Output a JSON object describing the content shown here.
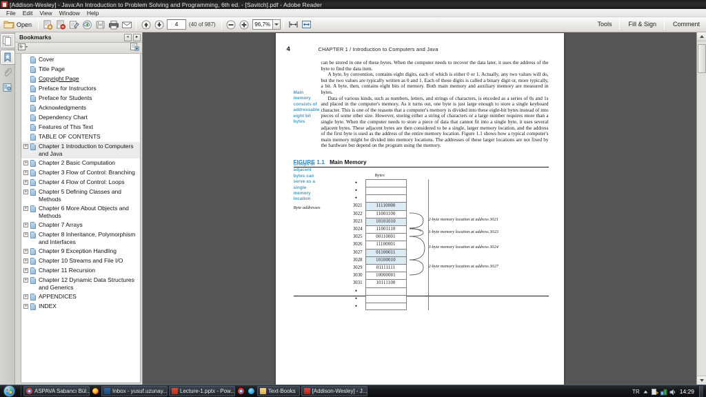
{
  "window": {
    "title": "[Addison-Wesley] - Java:An Introduction to Problem Solving and Programming, 6th ed. - [Savitch].pdf - Adobe Reader",
    "app_icon": "adobe-reader-icon"
  },
  "menubar": {
    "items": [
      "File",
      "Edit",
      "View",
      "Window",
      "Help"
    ]
  },
  "toolbar": {
    "open_label": "Open",
    "page_value": "4",
    "page_count_label": "(40 of 987)",
    "zoom_value": "96,7%",
    "right_buttons": [
      "Tools",
      "Fill & Sign",
      "Comment"
    ],
    "icons": [
      "open-folder-icon",
      "save-file-icon",
      "attach-file-icon",
      "sign-document-icon",
      "upload-cloud-icon",
      "save-disk-icon",
      "print-icon",
      "email-icon",
      "previous-page-icon",
      "next-page-icon",
      "zoom-out-icon",
      "zoom-in-icon",
      "zoom-dropdown-icon",
      "fit-width-icon",
      "fit-page-icon"
    ]
  },
  "rail": {
    "items": [
      {
        "name": "page-thumbnails-icon",
        "label": "Page Thumbnails"
      },
      {
        "name": "bookmarks-icon",
        "label": "Bookmarks"
      },
      {
        "name": "attachments-icon",
        "label": "Attachments"
      },
      {
        "name": "signatures-icon",
        "label": "Signatures"
      }
    ]
  },
  "bookmarks_panel": {
    "header": "Bookmarks",
    "collapse_label": "«",
    "options_label": "▸",
    "items": [
      {
        "label": "Cover",
        "expandable": false,
        "link": false,
        "selected": false
      },
      {
        "label": "Title Page",
        "expandable": false,
        "link": false,
        "selected": false
      },
      {
        "label": "Copyright Page",
        "expandable": false,
        "link": true,
        "selected": false
      },
      {
        "label": "Preface for Instructors",
        "expandable": false,
        "link": false,
        "selected": false
      },
      {
        "label": "Preface for Students",
        "expandable": false,
        "link": false,
        "selected": false
      },
      {
        "label": "Acknowledgments",
        "expandable": false,
        "link": false,
        "selected": false
      },
      {
        "label": "Dependency Chart",
        "expandable": false,
        "link": false,
        "selected": false
      },
      {
        "label": "Features of This Text",
        "expandable": false,
        "link": false,
        "selected": false
      },
      {
        "label": "TABLE OF CONTENTS",
        "expandable": false,
        "link": false,
        "selected": false
      },
      {
        "label": "Chapter 1 Introduction to Computers and Java",
        "expandable": true,
        "link": false,
        "selected": true
      },
      {
        "label": "Chapter 2 Basic Computation",
        "expandable": true,
        "link": false,
        "selected": false
      },
      {
        "label": "Chapter 3 Flow of Control: Branching",
        "expandable": true,
        "link": false,
        "selected": false
      },
      {
        "label": "Chapter 4 Flow of Control: Loops",
        "expandable": true,
        "link": false,
        "selected": false
      },
      {
        "label": "Chapter 5 Defining Classes and Methods",
        "expandable": true,
        "link": false,
        "selected": false
      },
      {
        "label": "Chapter 6 More About Objects and Methods",
        "expandable": true,
        "link": false,
        "selected": false
      },
      {
        "label": "Chapter 7 Arrays",
        "expandable": true,
        "link": false,
        "selected": false
      },
      {
        "label": "Chapter 8 Inheritance, Polymorphism and Interfaces",
        "expandable": true,
        "link": false,
        "selected": false
      },
      {
        "label": "Chapter 9 Exception Handling",
        "expandable": true,
        "link": false,
        "selected": false
      },
      {
        "label": "Chapter 10 Streams and File I/O",
        "expandable": true,
        "link": false,
        "selected": false
      },
      {
        "label": "Chapter 11 Recursion",
        "expandable": true,
        "link": false,
        "selected": false
      },
      {
        "label": "Chapter 12 Dynamic Data Structures and Generics",
        "expandable": true,
        "link": false,
        "selected": false
      },
      {
        "label": "APPENDICES",
        "expandable": true,
        "link": false,
        "selected": false
      },
      {
        "label": "INDEX",
        "expandable": true,
        "link": false,
        "selected": false
      }
    ]
  },
  "document": {
    "page_number": "4",
    "running_head": "CHAPTER 1 / Introduction to Computers and Java",
    "margin_notes": [
      "Main memory consists of addressable eight bit bytes",
      "Groups of adjacent bytes can serve as a single memory location"
    ],
    "paragraphs": [
      "can be stored in one of these bytes. When the computer needs to recover the data later, it uses the address of the byte to find the data item.",
      "A byte, by convention, contains eight digits, each of which is either 0 or 1. Actually, any two values will do, but the two values are typically written as 0 and 1. Each of these digits is called a binary digit or, more typically, a bit. A byte, then, contains eight bits of memory. Both main memory and auxiliary memory are measured in bytes.",
      "Data of various kinds, such as numbers, letters, and strings of characters, is encoded as a series of 0s and 1s and placed in the computer's memory. As it turns out, one byte is just large enough to store a single keyboard character. This is one of the reasons that a computer's memory is divided into these eight-bit bytes instead of into pieces of some other size. However, storing either a string of characters or a large number requires more than a single byte. When the computer needs to store a piece of data that cannot fit into a single byte, it uses several adjacent bytes. These adjacent bytes are then considered to be a single, larger memory location, and the address of the first byte is used as the address of the entire memory location. Figure 1.1 shows how a typical computer's main memory might be divided into memory locations. The addresses of these larger locations are not fixed by the hardware but depend on the program using the memory."
    ],
    "figure": {
      "label": "FIGURE 1.1",
      "title": "Main Memory",
      "column_caption": "Bytes",
      "address_caption": "Byte addresses",
      "rows": [
        {
          "address": "•",
          "value": "",
          "highlight": false,
          "dots": true
        },
        {
          "address": "•",
          "value": "",
          "highlight": false,
          "dots": true
        },
        {
          "address": "•",
          "value": "",
          "highlight": false,
          "dots": true
        },
        {
          "address": "3021",
          "value": "11110000",
          "highlight": true,
          "dots": false
        },
        {
          "address": "3022",
          "value": "11001100",
          "highlight": false,
          "dots": false
        },
        {
          "address": "3023",
          "value": "10101010",
          "highlight": true,
          "dots": false
        },
        {
          "address": "3024",
          "value": "11001110",
          "highlight": false,
          "dots": false
        },
        {
          "address": "3025",
          "value": "00110001",
          "highlight": false,
          "dots": false
        },
        {
          "address": "3026",
          "value": "11100001",
          "highlight": false,
          "dots": false
        },
        {
          "address": "3027",
          "value": "01100011",
          "highlight": true,
          "dots": false
        },
        {
          "address": "3028",
          "value": "10100010",
          "highlight": true,
          "dots": false
        },
        {
          "address": "3029",
          "value": "01111111",
          "highlight": false,
          "dots": false
        },
        {
          "address": "3030",
          "value": "10000001",
          "highlight": false,
          "dots": false
        },
        {
          "address": "3031",
          "value": "10111100",
          "highlight": false,
          "dots": false
        },
        {
          "address": "•",
          "value": "",
          "highlight": false,
          "dots": true
        },
        {
          "address": "•",
          "value": "",
          "highlight": false,
          "dots": true
        },
        {
          "address": "•",
          "value": "",
          "highlight": false,
          "dots": true
        }
      ],
      "annotations": [
        "2-byte memory location at address 3021",
        "1-byte memory location at address 3023",
        "3-byte memory location at address 3024",
        "2-byte memory location at address 3027"
      ]
    }
  },
  "taskbar": {
    "start_label": "start-orb-icon",
    "items": [
      {
        "label": "ASPAVA Sabancı Bül...",
        "icon": "chrome-icon",
        "boxed": true
      },
      {
        "label": "",
        "icon": "firefox-icon",
        "boxed": false
      },
      {
        "label": "Inbox - yusuf.uzunay...",
        "icon": "outlook-icon",
        "boxed": true
      },
      {
        "label": "Lecture-1.pptx - Pow...",
        "icon": "powerpoint-icon",
        "boxed": true
      },
      {
        "label": "",
        "icon": "chrome-icon",
        "boxed": false
      },
      {
        "label": "",
        "icon": "skype-icon",
        "boxed": false
      },
      {
        "label": "Text-Books",
        "icon": "folder-icon",
        "boxed": true
      },
      {
        "label": "[Addison-Wesley] - J...",
        "icon": "adobe-reader-icon",
        "boxed": true
      }
    ],
    "tray": {
      "language": "TR",
      "icons": [
        "show-hidden-icons",
        "warning-flag-icon",
        "network-icon",
        "volume-icon"
      ],
      "clock": "14:29"
    }
  }
}
